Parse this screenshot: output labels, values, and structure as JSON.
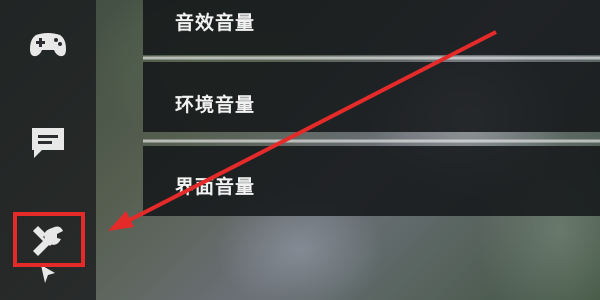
{
  "settings": {
    "items": [
      {
        "label": "音效音量"
      },
      {
        "label": "环境音量"
      },
      {
        "label": "界面音量"
      }
    ]
  },
  "sidebar": {
    "icons": [
      "gamepad-icon",
      "chat-icon",
      "wrench-settings-icon",
      "cursor-icon"
    ],
    "selected": "wrench-settings-icon"
  },
  "annotation": {
    "color": "#e52a2a",
    "target": "wrench-settings-icon"
  }
}
